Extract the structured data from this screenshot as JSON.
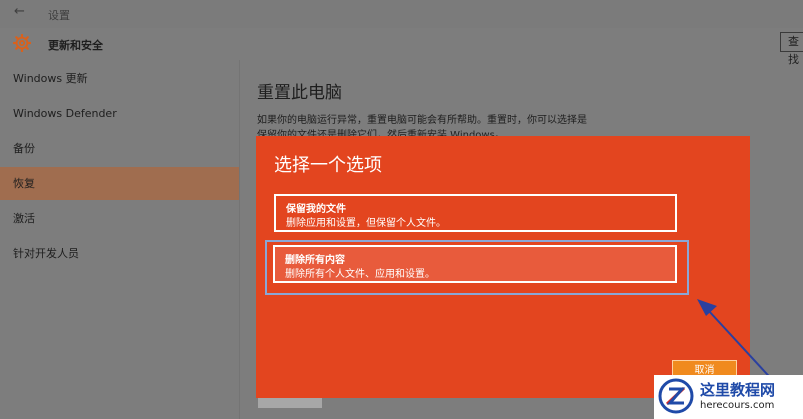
{
  "window": {
    "title": "设置",
    "back_glyph": "←"
  },
  "header": {
    "section_title": "更新和安全",
    "search_placeholder": "查找"
  },
  "sidebar": {
    "items": [
      {
        "label": "Windows 更新"
      },
      {
        "label": "Windows Defender"
      },
      {
        "label": "备份"
      },
      {
        "label": "恢复",
        "active": true
      },
      {
        "label": "激活"
      },
      {
        "label": "针对开发人员"
      }
    ]
  },
  "main": {
    "title": "重置此电脑",
    "description": "如果你的电脑运行异常，重置电脑可能会有所帮助。重置时，你可以选择是保留你的文件还是删除它们，然后重新安装 Windows。"
  },
  "dialog": {
    "title": "选择一个选项",
    "options": [
      {
        "title": "保留我的文件",
        "desc": "删除应用和设置，但保留个人文件。"
      },
      {
        "title": "删除所有内容",
        "desc": "删除所有个人文件、应用和设置。"
      }
    ],
    "cancel_label": "取消"
  },
  "watermark": {
    "name": "这里教程网",
    "url": "herecours.com"
  },
  "colors": {
    "dialog_bg": "#e3451f",
    "cancel_bg": "#f08a1e",
    "active_item_bg": "#a06d4f",
    "focus_ring": "#8aa7d6",
    "annotation_arrow": "#2a40a0"
  },
  "icons": {
    "back": "back-arrow-icon",
    "settings": "gear-icon",
    "watermark": "watermark-logo-icon"
  }
}
